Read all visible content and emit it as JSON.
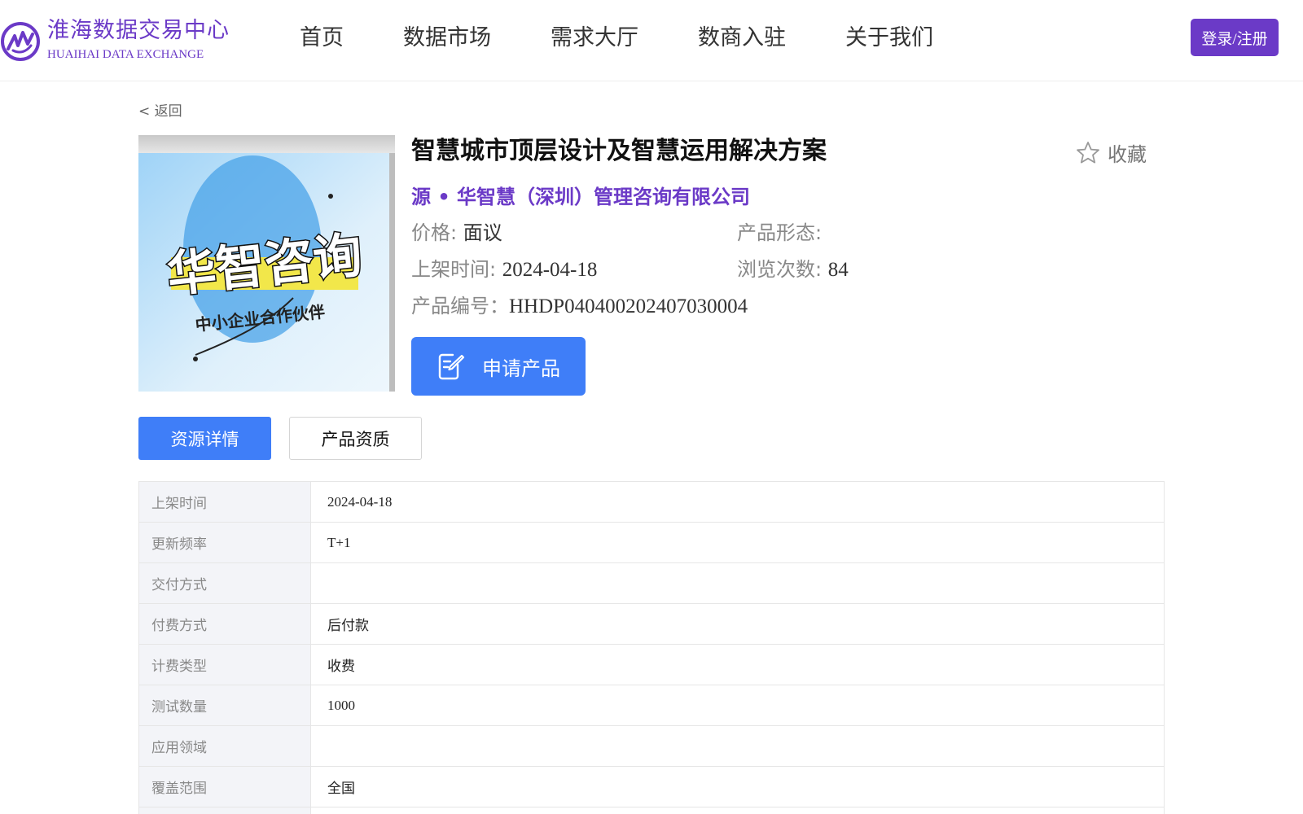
{
  "brand": {
    "name_cn": "淮海数据交易中心",
    "name_en": "HUAIHAI DATA EXCHANGE",
    "color": "#6b3ac7"
  },
  "nav": {
    "items": [
      "首页",
      "数据市场",
      "需求大厅",
      "数商入驻",
      "关于我们"
    ],
    "login_label": "登录/注册"
  },
  "back_label": "< 返回",
  "product": {
    "image": {
      "main_text": "华智咨询",
      "sub_text": "中小企业合作伙伴",
      "icon": "product-cover-image"
    },
    "title": "智慧城市顶层设计及智慧运用解决方案",
    "favorite_label": "收藏",
    "vendor": "源 • 华智慧（深圳）管理咨询有限公司",
    "price_label": "价格:",
    "price_value": "面议",
    "form_label": "产品形态:",
    "form_value": "",
    "listed_label": "上架时间:",
    "listed_value": "2024-04-18",
    "views_label": "浏览次数:",
    "views_value": "84",
    "code_label": "产品编号：",
    "code_value": "HHDP040400202407030004",
    "apply_label": "申请产品"
  },
  "tabs": [
    "资源详情",
    "产品资质"
  ],
  "details": [
    {
      "key": "上架时间",
      "value": "2024-04-18"
    },
    {
      "key": "更新频率",
      "value": "T+1"
    },
    {
      "key": "交付方式",
      "value": ""
    },
    {
      "key": "付费方式",
      "value": "后付款"
    },
    {
      "key": "计费类型",
      "value": "收费"
    },
    {
      "key": "测试数量",
      "value": "1000"
    },
    {
      "key": "应用领域",
      "value": ""
    },
    {
      "key": "覆盖范围",
      "value": "全国"
    }
  ],
  "colors": {
    "accent_blue": "#3f7ef8",
    "brand_purple": "#6b3ac7"
  }
}
